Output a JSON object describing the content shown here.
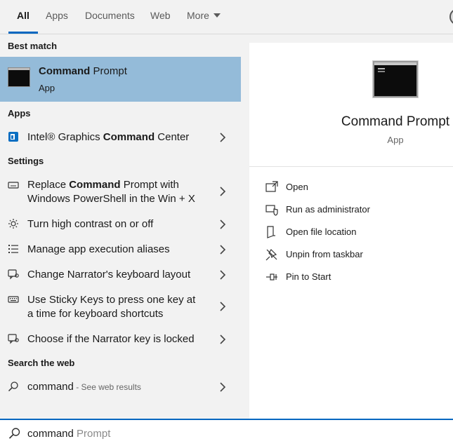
{
  "tabs": [
    {
      "label": "All",
      "active": true
    },
    {
      "label": "Apps"
    },
    {
      "label": "Documents"
    },
    {
      "label": "Web"
    },
    {
      "label": "More"
    }
  ],
  "sections": {
    "best_match": "Best match",
    "apps": "Apps",
    "settings": "Settings",
    "search_web": "Search the web"
  },
  "best_match": {
    "title_bold": "Command",
    "title_rest": " Prompt",
    "subtitle": "App",
    "icon": "command-prompt-icon"
  },
  "apps": [
    {
      "pre": "Intel® Graphics ",
      "bold": "Command",
      "post": " Center",
      "icon": "intel-graphics-icon"
    }
  ],
  "settings": [
    {
      "pre": "Replace ",
      "bold": "Command",
      "post": " Prompt with Windows PowerShell in the Win + X",
      "icon": "keyboard-icon"
    },
    {
      "pre": "Turn high contrast on or off",
      "bold": "",
      "post": "",
      "icon": "brightness-icon"
    },
    {
      "pre": "Manage app execution aliases",
      "bold": "",
      "post": "",
      "icon": "list-icon"
    },
    {
      "pre": "Change Narrator's keyboard layout",
      "bold": "",
      "post": "",
      "icon": "narrator-icon"
    },
    {
      "pre": "Use Sticky Keys to press one key at a time for keyboard shortcuts",
      "bold": "",
      "post": "",
      "icon": "keyboard-icon"
    },
    {
      "pre": "Choose if the Narrator key is locked",
      "bold": "",
      "post": "",
      "icon": "narrator-icon"
    }
  ],
  "web": {
    "query": "command",
    "suffix": " - See web results",
    "icon": "search-icon"
  },
  "details": {
    "title": "Command Prompt",
    "type": "App",
    "actions": [
      {
        "label": "Open",
        "icon": "open-icon"
      },
      {
        "label": "Run as administrator",
        "icon": "shield-icon"
      },
      {
        "label": "Open file location",
        "icon": "file-location-icon"
      },
      {
        "label": "Unpin from taskbar",
        "icon": "unpin-icon"
      },
      {
        "label": "Pin to Start",
        "icon": "pin-icon"
      }
    ]
  },
  "search": {
    "typed": "command",
    "suggestion": " Prompt",
    "icon": "search-icon"
  },
  "colors": {
    "accent": "#0067c0",
    "selected_bg": "#94bbd9"
  }
}
